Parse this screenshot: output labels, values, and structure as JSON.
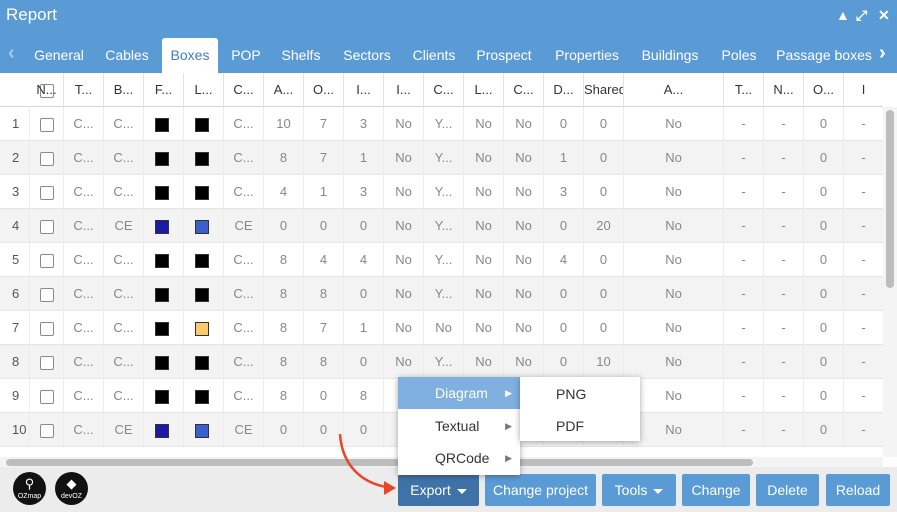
{
  "window": {
    "title": "Report",
    "controls": [
      "▲",
      "⤢",
      "✕"
    ]
  },
  "tabs": [
    "General",
    "Cables",
    "Boxes",
    "POP",
    "Shelfs",
    "Sectors",
    "Clients",
    "Prospect",
    "Properties",
    "Buildings",
    "Poles",
    "Passage boxes"
  ],
  "active_tab": "Boxes",
  "tab_arrows": {
    "left": "‹",
    "right": "›"
  },
  "columns": [
    "",
    "N...",
    "T...",
    "B...",
    "F...",
    "L...",
    "C...",
    "A...",
    "O...",
    "I...",
    "I...",
    "C...",
    "L...",
    "C...",
    "D...",
    "Shared",
    "A...",
    "T...",
    "N...",
    "O...",
    "I"
  ],
  "rows": [
    [
      "1",
      "C...",
      "C...",
      "#000000",
      "#000000",
      "C...",
      "10",
      "7",
      "3",
      "No",
      "Y...",
      "No",
      "No",
      "0",
      "0",
      "No",
      "-",
      "-",
      "0",
      "-"
    ],
    [
      "2",
      "C...",
      "C...",
      "#000000",
      "#000000",
      "C...",
      "8",
      "7",
      "1",
      "No",
      "Y...",
      "No",
      "No",
      "1",
      "0",
      "No",
      "-",
      "-",
      "0",
      "-"
    ],
    [
      "3",
      "C...",
      "C...",
      "#000000",
      "#000000",
      "C...",
      "4",
      "1",
      "3",
      "No",
      "Y...",
      "No",
      "No",
      "3",
      "0",
      "No",
      "-",
      "-",
      "0",
      "-"
    ],
    [
      "4",
      "C...",
      "CE",
      "#1a1aa6",
      "#3a5fcd",
      "CE",
      "0",
      "0",
      "0",
      "No",
      "Y...",
      "No",
      "No",
      "0",
      "20",
      "No",
      "-",
      "-",
      "0",
      "-"
    ],
    [
      "5",
      "C...",
      "C...",
      "#000000",
      "#000000",
      "C...",
      "8",
      "4",
      "4",
      "No",
      "Y...",
      "No",
      "No",
      "4",
      "0",
      "No",
      "-",
      "-",
      "0",
      "-"
    ],
    [
      "6",
      "C...",
      "C...",
      "#000000",
      "#000000",
      "C...",
      "8",
      "8",
      "0",
      "No",
      "Y...",
      "No",
      "No",
      "0",
      "0",
      "No",
      "-",
      "-",
      "0",
      "-"
    ],
    [
      "7",
      "C...",
      "C...",
      "#000000",
      "#ffc970",
      "C...",
      "8",
      "7",
      "1",
      "No",
      "No",
      "No",
      "No",
      "0",
      "0",
      "No",
      "-",
      "-",
      "0",
      "-"
    ],
    [
      "8",
      "C...",
      "C...",
      "#000000",
      "#000000",
      "C...",
      "8",
      "8",
      "0",
      "No",
      "Y...",
      "No",
      "No",
      "0",
      "10",
      "No",
      "-",
      "-",
      "0",
      "-"
    ],
    [
      "9",
      "C...",
      "C...",
      "#000000",
      "#000000",
      "C...",
      "8",
      "0",
      "8",
      "",
      "",
      "",
      "",
      "",
      "",
      "No",
      "-",
      "-",
      "0",
      "-"
    ],
    [
      "10",
      "C...",
      "CE",
      "#1a1aa6",
      "#3a5fcd",
      "CE",
      "0",
      "0",
      "0",
      "",
      "",
      "",
      "",
      "",
      "",
      "No",
      "-",
      "-",
      "0",
      "-"
    ]
  ],
  "footer": {
    "logos": [
      {
        "glyph": "⚲",
        "label": "OZmap"
      },
      {
        "glyph": "◆",
        "label": "devOZ"
      }
    ],
    "buttons": [
      "Export",
      "Change project",
      "Tools",
      "Change",
      "Delete",
      "Reload"
    ]
  },
  "export_menu": {
    "items": [
      "Diagram",
      "Textual",
      "QRCode"
    ],
    "active": "Diagram",
    "submenu": [
      "PNG",
      "PDF"
    ]
  },
  "colors": {
    "accent": "#5b9bd5",
    "menu_highlight": "#7fb0e0",
    "annotation_arrow": "#e8452c"
  }
}
